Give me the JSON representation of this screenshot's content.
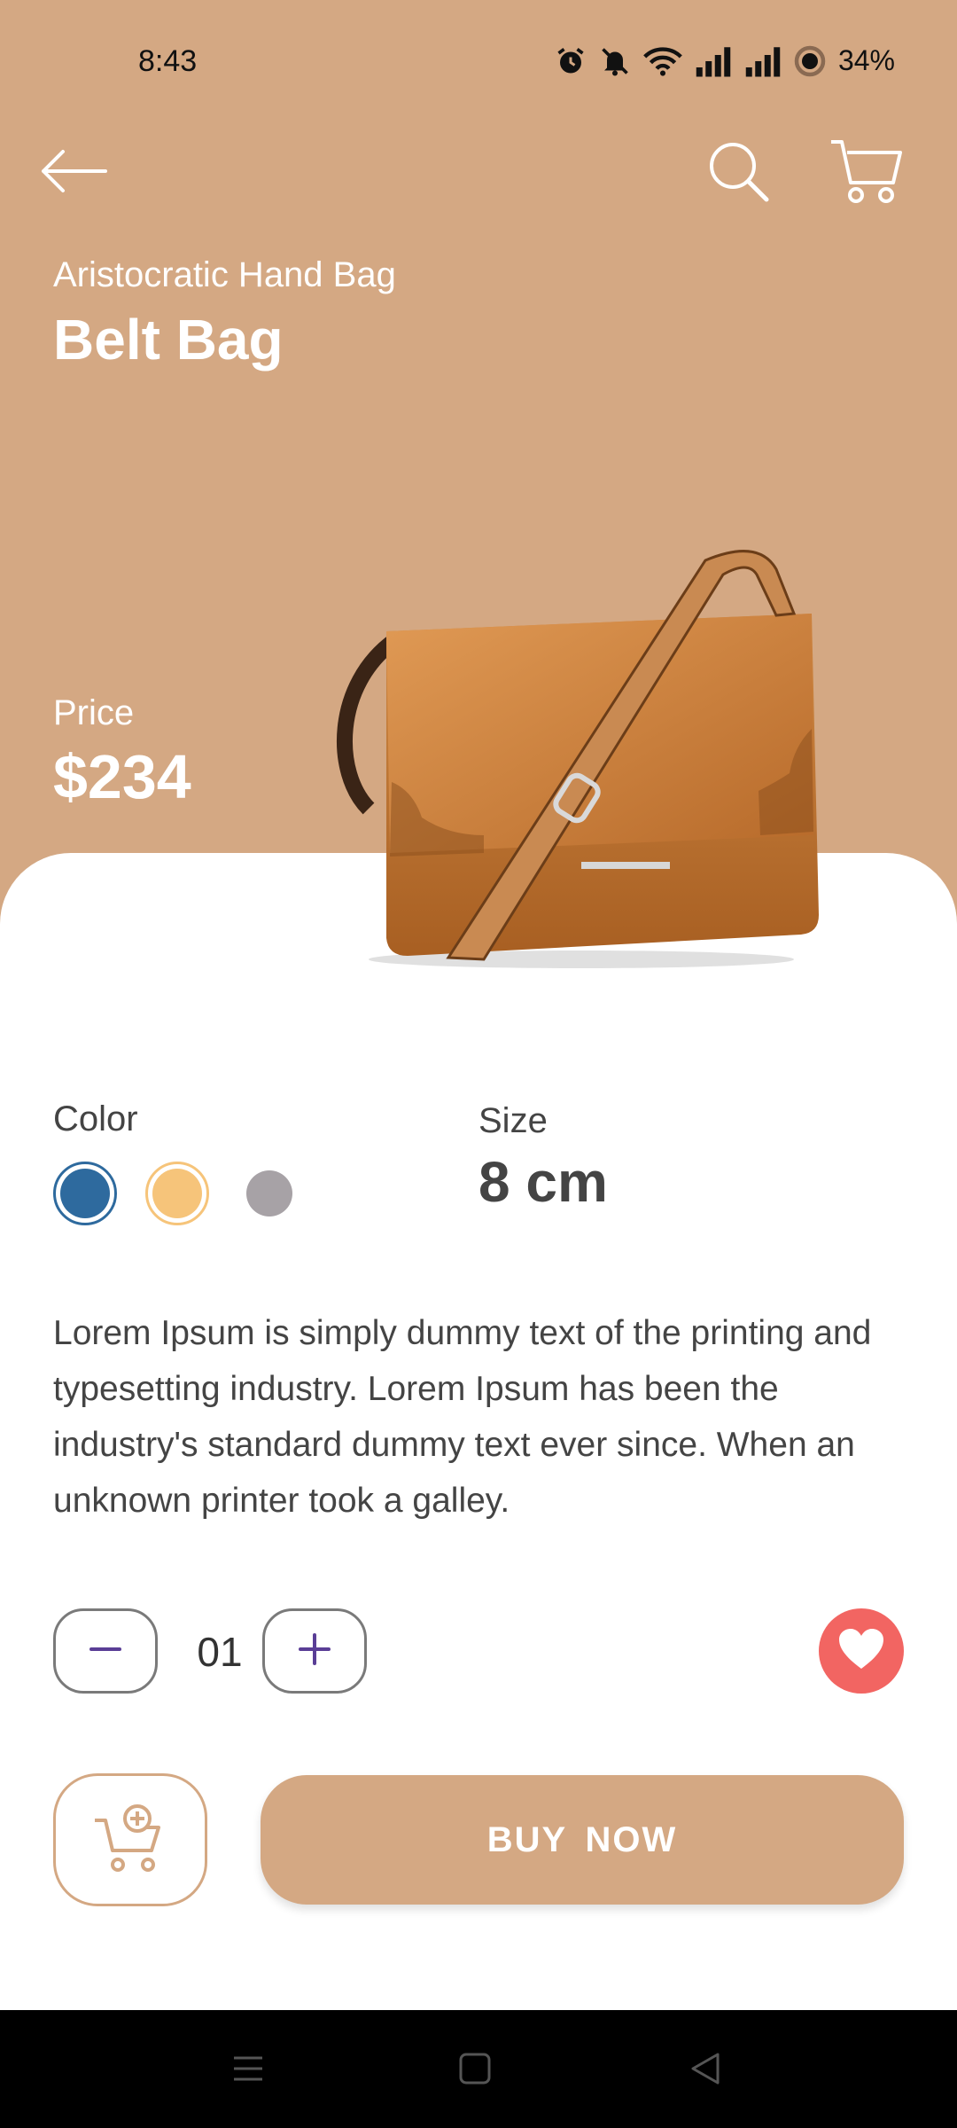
{
  "status_bar": {
    "time": "8:43",
    "battery": "34%",
    "icons": [
      "alarm-icon",
      "mute-icon",
      "wifi-icon",
      "signal-icon",
      "signal-icon",
      "battery-saver-icon"
    ]
  },
  "nav": {
    "icons": [
      "back-arrow-icon",
      "search-icon",
      "cart-icon"
    ]
  },
  "product": {
    "subtitle": "Aristocratic Hand Bag",
    "title": "Belt Bag",
    "price_label": "Price",
    "price": "$234",
    "color_label": "Color",
    "colors": [
      "#2e6a9e",
      "#f6c47a",
      "#a7a2a6"
    ],
    "selected_color": "#2e6a9e",
    "size_label": "Size",
    "size": "8 cm",
    "description": "Lorem Ipsum is simply dummy text of the printing and typesetting industry. Lorem Ipsum has been the industry's standard dummy text ever since. When an unknown printer took a galley."
  },
  "quantity": {
    "value": "01",
    "minus_icon": "minus-icon",
    "plus_icon": "plus-icon"
  },
  "actions": {
    "favorite_icon": "heart-icon",
    "add_to_cart_icon": "cart-plus-icon",
    "buy_label": "BUY  NOW"
  },
  "colors": {
    "brand": "#d4a883",
    "favorite": "#f26562",
    "text": "#444444"
  }
}
